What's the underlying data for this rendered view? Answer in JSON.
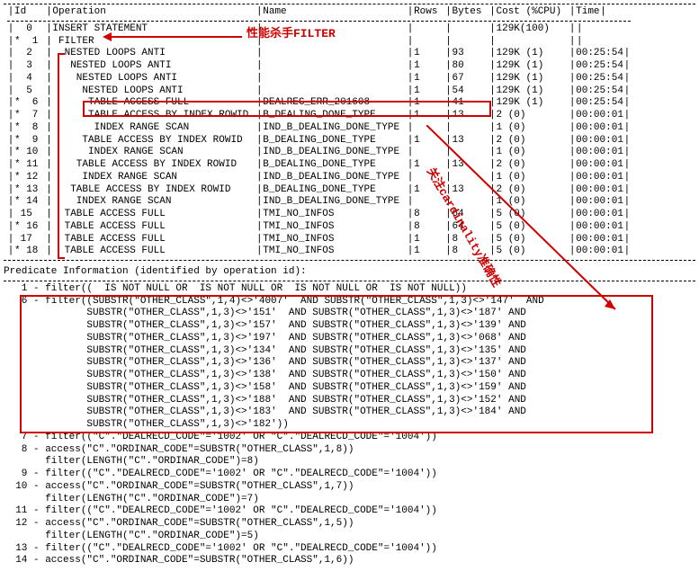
{
  "headers": [
    "Id",
    "Operation",
    "Name",
    "Rows",
    "Bytes",
    "Cost (%CPU)",
    "Time"
  ],
  "annotations": {
    "filter_label": "性能杀手FILTER",
    "cardinality_label": "关注cardinality准确性"
  },
  "plan": [
    {
      "star": "",
      "id": "0",
      "op": "INSERT STATEMENT",
      "name": "",
      "rows": "",
      "bytes": "",
      "cost": "129K(100)",
      "time": ""
    },
    {
      "star": "*",
      "id": "1",
      "op": "FILTER",
      "name": "",
      "rows": "",
      "bytes": "",
      "cost": "",
      "time": ""
    },
    {
      "star": "",
      "id": "2",
      "op": "NESTED LOOPS ANTI",
      "name": "",
      "rows": "1",
      "bytes": "93",
      "cost": "129K   (1)",
      "time": "00:25:54"
    },
    {
      "star": "",
      "id": "3",
      "op": "NESTED LOOPS ANTI",
      "name": "",
      "rows": "1",
      "bytes": "80",
      "cost": "129K   (1)",
      "time": "00:25:54"
    },
    {
      "star": "",
      "id": "4",
      "op": "NESTED LOOPS ANTI",
      "name": "",
      "rows": "1",
      "bytes": "67",
      "cost": "129K   (1)",
      "time": "00:25:54"
    },
    {
      "star": "",
      "id": "5",
      "op": "NESTED LOOPS ANTI",
      "name": "",
      "rows": "1",
      "bytes": "54",
      "cost": "129K   (1)",
      "time": "00:25:54"
    },
    {
      "star": "*",
      "id": "6",
      "op": "TABLE ACCESS FULL",
      "name": "DEALREC_ERR_201608",
      "rows": "1",
      "bytes": "41",
      "cost": "129K   (1)",
      "time": "00:25:54"
    },
    {
      "star": "*",
      "id": "7",
      "op": "TABLE ACCESS BY INDEX ROWID",
      "name": "B_DEALING_DONE_TYPE",
      "rows": "1",
      "bytes": "13",
      "cost": "2   (0)",
      "time": "00:00:01"
    },
    {
      "star": "*",
      "id": "8",
      "op": "INDEX RANGE SCAN",
      "name": "IND_B_DEALING_DONE_TYPE",
      "rows": "",
      "bytes": "",
      "cost": "1   (0)",
      "time": "00:00:01"
    },
    {
      "star": "*",
      "id": "9",
      "op": "TABLE ACCESS BY INDEX ROWID",
      "name": "B_DEALING_DONE_TYPE",
      "rows": "1",
      "bytes": "13",
      "cost": "2   (0)",
      "time": "00:00:01"
    },
    {
      "star": "*",
      "id": "10",
      "op": "INDEX RANGE SCAN",
      "name": "IND_B_DEALING_DONE_TYPE",
      "rows": "",
      "bytes": "",
      "cost": "1   (0)",
      "time": "00:00:01"
    },
    {
      "star": "*",
      "id": "11",
      "op": "TABLE ACCESS BY INDEX ROWID",
      "name": "B_DEALING_DONE_TYPE",
      "rows": "1",
      "bytes": "13",
      "cost": "2   (0)",
      "time": "00:00:01"
    },
    {
      "star": "*",
      "id": "12",
      "op": "INDEX RANGE SCAN",
      "name": "IND_B_DEALING_DONE_TYPE",
      "rows": "",
      "bytes": "",
      "cost": "1   (0)",
      "time": "00:00:01"
    },
    {
      "star": "*",
      "id": "13",
      "op": "TABLE ACCESS BY INDEX ROWID",
      "name": "B_DEALING_DONE_TYPE",
      "rows": "1",
      "bytes": "13",
      "cost": "2   (0)",
      "time": "00:00:01"
    },
    {
      "star": "*",
      "id": "14",
      "op": "INDEX RANGE SCAN",
      "name": "IND_B_DEALING_DONE_TYPE",
      "rows": "",
      "bytes": "",
      "cost": "1   (0)",
      "time": "00:00:01"
    },
    {
      "star": "",
      "id": "15",
      "op": "TABLE ACCESS FULL",
      "name": "TMI_NO_INFOS",
      "rows": "8",
      "bytes": "64",
      "cost": "5   (0)",
      "time": "00:00:01"
    },
    {
      "star": "*",
      "id": "16",
      "op": "TABLE ACCESS FULL",
      "name": "TMI_NO_INFOS",
      "rows": "8",
      "bytes": "64",
      "cost": "5   (0)",
      "time": "00:00:01"
    },
    {
      "star": "",
      "id": "17",
      "op": "TABLE ACCESS FULL",
      "name": "TMI_NO_INFOS",
      "rows": "1",
      "bytes": "8",
      "cost": "5   (0)",
      "time": "00:00:01"
    },
    {
      "star": "*",
      "id": "18",
      "op": "TABLE ACCESS FULL",
      "name": "TMI_NO_INFOS",
      "rows": "1",
      "bytes": "8",
      "cost": "5   (0)",
      "time": "00:00:01"
    }
  ],
  "indents": [
    0,
    1,
    2,
    3,
    4,
    5,
    6,
    6,
    7,
    5,
    6,
    4,
    5,
    3,
    4,
    2,
    2,
    2,
    2
  ],
  "predicate_header": "Predicate Information (identified by operation id):",
  "predicates": [
    "   1 - filter((  IS NOT NULL OR  IS NOT NULL OR  IS NOT NULL OR  IS NOT NULL))",
    "   6 - filter((SUBSTR(\"OTHER_CLASS\",1,4)<>'4007'  AND SUBSTR(\"OTHER_CLASS\",1,3)<>'147'  AND",
    "              SUBSTR(\"OTHER_CLASS\",1,3)<>'151'  AND SUBSTR(\"OTHER_CLASS\",1,3)<>'187' AND",
    "              SUBSTR(\"OTHER_CLASS\",1,3)<>'157'  AND SUBSTR(\"OTHER_CLASS\",1,3)<>'139' AND",
    "              SUBSTR(\"OTHER_CLASS\",1,3)<>'197'  AND SUBSTR(\"OTHER_CLASS\",1,3)<>'068' AND",
    "              SUBSTR(\"OTHER_CLASS\",1,3)<>'134'  AND SUBSTR(\"OTHER_CLASS\",1,3)<>'135' AND",
    "              SUBSTR(\"OTHER_CLASS\",1,3)<>'136'  AND SUBSTR(\"OTHER_CLASS\",1,3)<>'137' AND",
    "              SUBSTR(\"OTHER_CLASS\",1,3)<>'138'  AND SUBSTR(\"OTHER_CLASS\",1,3)<>'150' AND",
    "              SUBSTR(\"OTHER_CLASS\",1,3)<>'158'  AND SUBSTR(\"OTHER_CLASS\",1,3)<>'159' AND",
    "              SUBSTR(\"OTHER_CLASS\",1,3)<>'188'  AND SUBSTR(\"OTHER_CLASS\",1,3)<>'152' AND",
    "              SUBSTR(\"OTHER_CLASS\",1,3)<>'183'  AND SUBSTR(\"OTHER_CLASS\",1,3)<>'184' AND",
    "              SUBSTR(\"OTHER_CLASS\",1,3)<>'182'))",
    "   7 - filter((\"C\".\"DEALRECD_CODE\"='1002' OR \"C\".\"DEALRECD_CODE\"='1004'))",
    "   8 - access(\"C\".\"ORDINAR_CODE\"=SUBSTR(\"OTHER_CLASS\",1,8))",
    "       filter(LENGTH(\"C\".\"ORDINAR_CODE\")=8)",
    "   9 - filter((\"C\".\"DEALRECD_CODE\"='1002' OR \"C\".\"DEALRECD_CODE\"='1004'))",
    "  10 - access(\"C\".\"ORDINAR_CODE\"=SUBSTR(\"OTHER_CLASS\",1,7))",
    "       filter(LENGTH(\"C\".\"ORDINAR_CODE\")=7)",
    "  11 - filter((\"C\".\"DEALRECD_CODE\"='1002' OR \"C\".\"DEALRECD_CODE\"='1004'))",
    "  12 - access(\"C\".\"ORDINAR_CODE\"=SUBSTR(\"OTHER_CLASS\",1,5))",
    "       filter(LENGTH(\"C\".\"ORDINAR_CODE\")=5)",
    "  13 - filter((\"C\".\"DEALRECD_CODE\"='1002' OR \"C\".\"DEALRECD_CODE\"='1004'))",
    "  14 - access(\"C\".\"ORDINAR_CODE\"=SUBSTR(\"OTHER_CLASS\",1,6))"
  ]
}
